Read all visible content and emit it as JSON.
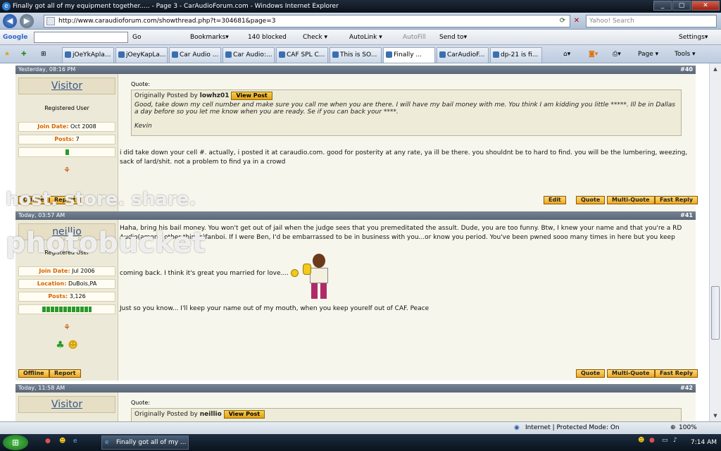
{
  "window": {
    "title": "Finally got all of my equipment together..... - Page 3 - CarAudioForum.com - Windows Internet Explorer",
    "min": "_",
    "max": "▢",
    "close": "✕"
  },
  "address": {
    "url": "http://www.caraudioforum.com/showthread.php?t=304681&page=3",
    "search_placeholder": "Yahoo! Search"
  },
  "google_bar": {
    "logo": "Google",
    "go": "Go",
    "bookmarks": "Bookmarks▾",
    "blocked": "140 blocked",
    "check": "Check ▾",
    "autolink": "AutoLink ▾",
    "autofill": "AutoFill",
    "sendto": "Send to▾",
    "settings": "Settings▾"
  },
  "tabs": [
    "jOeYkApla...",
    "jOeyKapLa...",
    "Car Audio ...",
    "Car Audio:...",
    "CAF SPL C...",
    "This is SO...",
    "Finally ...",
    "CarAudioF...",
    "dp-21 is fi..."
  ],
  "toolbar": {
    "page": "Page ▾",
    "tools": "Tools ▾"
  },
  "posts": [
    {
      "date": "Yesterday, 08:16 PM",
      "number": "#40",
      "username": "Visitor",
      "title": "Registered User",
      "join_label": "Join Date:",
      "join_value": "Oct 2008",
      "posts_label": "Posts:",
      "posts_value": "7",
      "quote_label": "Quote:",
      "quote_by_prefix": "Originally Posted by",
      "quote_author": "lowhz01",
      "view_post": "View Post",
      "quote_text": "Good, take down my cell number and make sure you call me when you are there. I will have my bail money with me. You think I am kidding you little *****. Ill be in Dallas a day before so you let me know when you are ready. Se if you can back your ****.",
      "quote_sig": "Kevin",
      "body": "i did take down your cell #. actually, i posted it at caraudio.com. good for posterity at any rate, ya ill be there. you shouldnt be to hard to find. you will be the lumbering, weezing, sack of lard/shit. not a problem to find ya in a crowd",
      "buttons": {
        "offline": "Offline",
        "report": "Report",
        "edit": "Edit",
        "quote": "Quote",
        "multi": "Multi-Quote",
        "fast": "Fast Reply"
      }
    },
    {
      "date": "Today, 03:57 AM",
      "number": "#41",
      "username": "neillio",
      "title": "Registered User",
      "join_label": "Join Date:",
      "join_value": "Jul 2006",
      "location_label": "Location:",
      "location_value": "DuBois,PA",
      "posts_label": "Posts:",
      "posts_value": "3,126",
      "body1": "Haha, bring his bail money. You won't get out of jail when the judge sees that you premeditated the assult. Dude, you are too funny. Btw, I knew your name and that you're a RD Audio(among other things)fanboi. If I were Ben, I'd be embarrassed to be in business with you...or know you period. You've been pwned sooo many times in here but you keep",
      "body2": "coming back. I think it's great you married for love....",
      "body3": "Just so you know... I'll keep your name out of my mouth, when you keep yourelf out of CAF. Peace",
      "buttons": {
        "offline": "Offline",
        "report": "Report",
        "quote": "Quote",
        "multi": "Multi-Quote",
        "fast": "Fast Reply"
      }
    },
    {
      "date": "Today, 11:58 AM",
      "number": "#42",
      "username": "Visitor",
      "quote_label": "Quote:",
      "quote_by_prefix": "Originally Posted by",
      "quote_author": "neillio",
      "view_post": "View Post"
    }
  ],
  "watermark": {
    "line1": "host. store. share.",
    "line2": "photobucket"
  },
  "status": {
    "zone": "Internet | Protected Mode: On",
    "zoom": "100%"
  },
  "taskbar": {
    "item": "Finally got all of my ...",
    "time": "7:14 AM"
  }
}
